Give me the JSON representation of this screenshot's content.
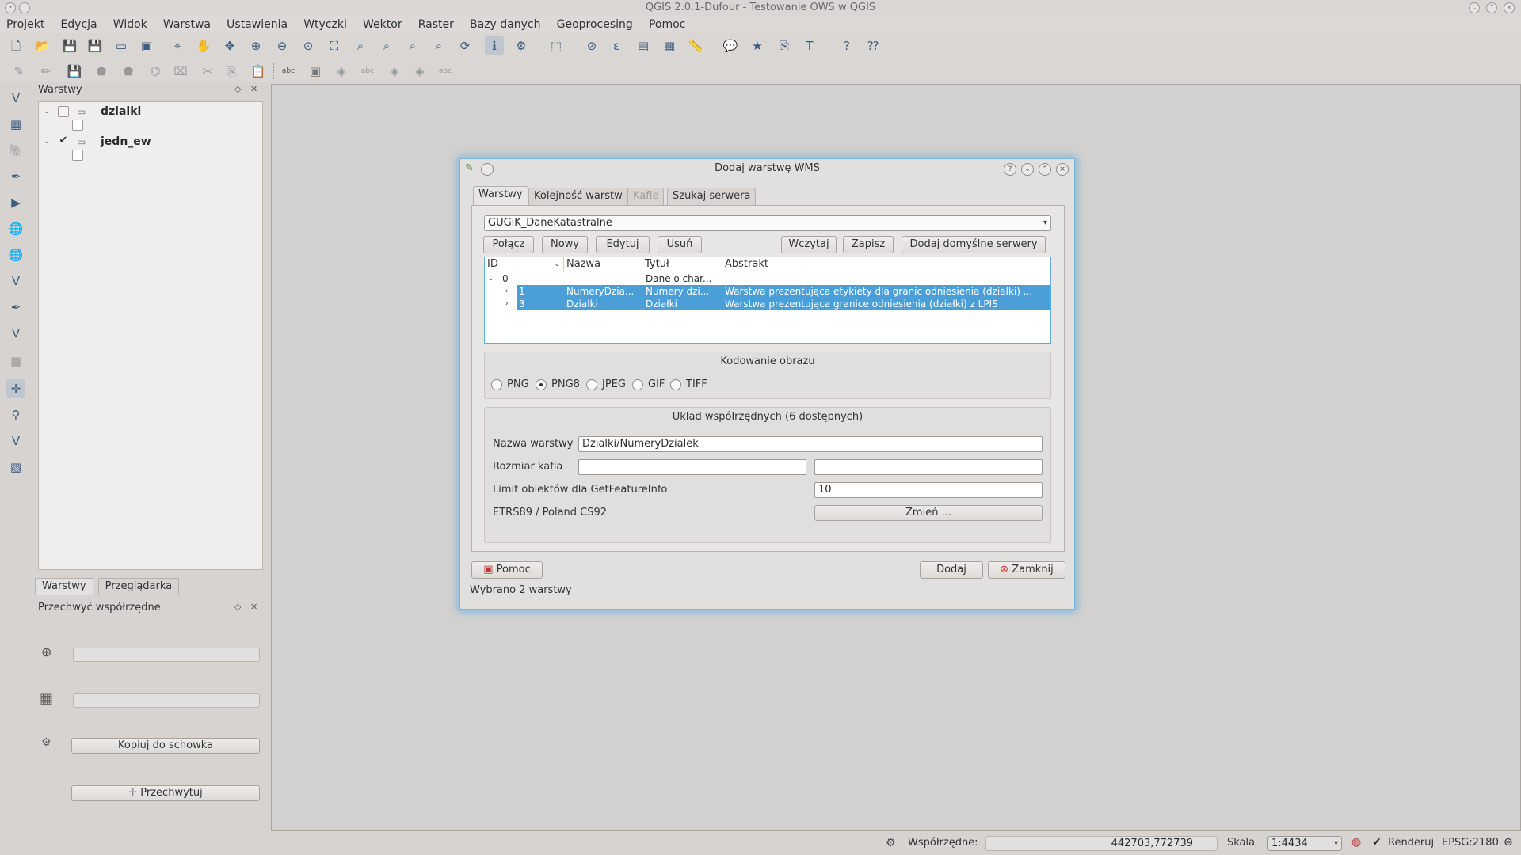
{
  "window": {
    "title": "QGIS 2.0.1-Dufour - Testowanie OWS w QGIS"
  },
  "menubar": [
    "Projekt",
    "Edycja",
    "Widok",
    "Warstwa",
    "Ustawienia",
    "Wtyczki",
    "Wektor",
    "Raster",
    "Bazy danych",
    "Geoprocesing",
    "Pomoc"
  ],
  "layers_panel": {
    "title": "Warstwy",
    "items": [
      {
        "name": "dzialki",
        "checked": false
      },
      {
        "name": "jedn_ew",
        "checked": true
      }
    ]
  },
  "bottom_tabs": [
    "Warstwy",
    "Przeglądarka"
  ],
  "coord_panel": {
    "title": "Przechwyć współrzędne",
    "copy_button": "Kopiuj do schowka",
    "capture_button": "Przechwytuj"
  },
  "dialog": {
    "title": "Dodaj warstwę WMS",
    "tabs": [
      "Warstwy",
      "Kolejność warstw",
      "Kafle",
      "Szukaj serwera"
    ],
    "server": "GUGiK_DaneKatastralne",
    "buttons": {
      "connect": "Połącz",
      "new": "Nowy",
      "edit": "Edytuj",
      "delete": "Usuń",
      "load": "Wczytaj",
      "save": "Zapisz",
      "add_defaults": "Dodaj domyślne serwery"
    },
    "table": {
      "headers": [
        "ID",
        "Nazwa",
        "Tytuł",
        "Abstrakt"
      ],
      "rows": [
        {
          "id": "0",
          "name": "",
          "title": "Dane o char...",
          "abstract": "",
          "selected": false
        },
        {
          "id": "1",
          "name": "NumeryDzia...",
          "title": "Numery dzi...",
          "abstract": "Warstwa prezentująca etykiety dla granic odniesienia (działki) ...",
          "selected": true
        },
        {
          "id": "3",
          "name": "Dzialki",
          "title": "Działki",
          "abstract": "Warstwa prezentująca granice odniesienia (działki) z LPIS",
          "selected": true
        }
      ]
    },
    "encoding": {
      "title": "Kodowanie obrazu",
      "options": [
        "PNG",
        "PNG8",
        "JPEG",
        "GIF",
        "TIFF"
      ],
      "selected": "PNG8"
    },
    "crs_group": {
      "title": "Układ współrzędnych (6 dostępnych)",
      "layer_name_label": "Nazwa warstwy",
      "layer_name_value": "Dzialki/NumeryDzialek",
      "tile_size_label": "Rozmiar kafla",
      "feature_limit_label": "Limit obiektów dla GetFeatureInfo",
      "feature_limit_value": "10",
      "crs_name": "ETRS89 / Poland CS92",
      "change_button": "Zmień ..."
    },
    "help_button": "Pomoc",
    "add_button": "Dodaj",
    "close_button": "Zamknij",
    "status": "Wybrano 2 warstwy"
  },
  "statusbar": {
    "coords_label": "Współrzędne:",
    "coords_value": "442703,772739",
    "scale_label": "Skala",
    "scale_value": "1:4434",
    "render_label": "Renderuj",
    "epsg": "EPSG:2180"
  }
}
